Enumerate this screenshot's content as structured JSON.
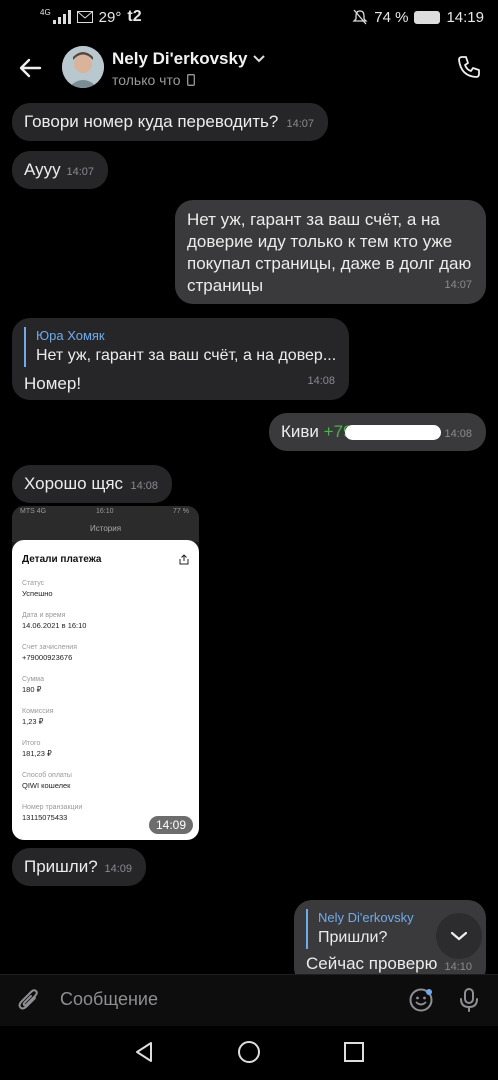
{
  "status_bar": {
    "network": "4G",
    "temperature": "29°",
    "carrier": "t2",
    "battery": "74 %",
    "time": "14:19"
  },
  "header": {
    "name": "Nely Di'erkovsky",
    "status": "только что"
  },
  "messages": [
    {
      "text": "Говори номер куда переводить?",
      "time": "14:07"
    },
    {
      "text": "Аууу",
      "time": "14:07"
    },
    {
      "lines": [
        "Нет уж, гарант за ваш счёт, а на",
        "доверие иду только к тем кто уже",
        "покупал страницы, даже в долг даю",
        "страницы"
      ],
      "time": "14:07"
    },
    {
      "reply_name": "Юра Хомяк",
      "reply_text": "Нет уж, гарант за ваш счёт, а на довер...",
      "text": "Номер!",
      "time": "14:08"
    },
    {
      "prefix": "Киви ",
      "number_visible": "+79",
      "time": "14:08"
    },
    {
      "text": "Хорошо щяс",
      "time": "14:08"
    },
    {
      "text": "Пришли?",
      "time": "14:09"
    },
    {
      "reply_name": "Nely Di'erkovsky",
      "reply_text": "Пришли?",
      "text": "Сейчас проверю",
      "time": "14:10"
    }
  ],
  "screenshot": {
    "time": "14:09",
    "top_bar": {
      "carrier": "MTS 4G",
      "clock": "16:10",
      "battery": "77 %",
      "title": "История"
    },
    "title": "Детали платежа",
    "fields": [
      {
        "label": "Статус",
        "value": "Успешно"
      },
      {
        "label": "Дата и время",
        "value": "14.06.2021 в 16:10"
      },
      {
        "label": "Счет зачисления",
        "value": "+79000923676"
      },
      {
        "label": "Сумма",
        "value": "180 ₽"
      },
      {
        "label": "Комиссия",
        "value": "1,23 ₽"
      },
      {
        "label": "Итого",
        "value": "181,23 ₽"
      },
      {
        "label": "Способ оплаты",
        "value": "QIWI кошелек"
      },
      {
        "label": "Номер транзакции",
        "value": "13115075433"
      }
    ]
  },
  "composer": {
    "placeholder": "Сообщение"
  },
  "colors": {
    "background": "#000000",
    "incoming_bubble": "#262629",
    "outgoing_bubble": "#3a3a3c",
    "accent": "#71aaeb",
    "green": "#4bb34b"
  },
  "icons": [
    "arrow-left-icon",
    "chevron-down-icon",
    "phone-icon",
    "paperclip-icon",
    "emoji-icon",
    "microphone-icon",
    "chevron-down-icon",
    "nav-back-icon",
    "nav-home-icon",
    "nav-recent-icon"
  ]
}
